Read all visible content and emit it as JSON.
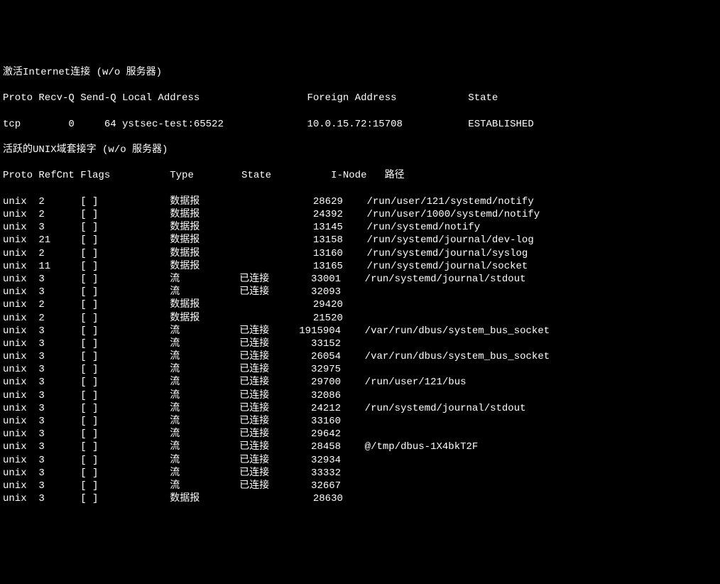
{
  "section1": {
    "title": "激活Internet连接 (w/o 服务器)",
    "header": {
      "proto": "Proto",
      "recvq": "Recv-Q",
      "sendq": "Send-Q",
      "local": "Local Address",
      "foreign": "Foreign Address",
      "state": "State"
    },
    "rows": [
      {
        "proto": "tcp",
        "recvq": "0",
        "sendq": "64",
        "local": "ystsec-test:65522",
        "foreign": "10.0.15.72:15708",
        "state": "ESTABLISHED"
      }
    ]
  },
  "section2": {
    "title": "活跃的UNIX域套接字 (w/o 服务器)",
    "header": {
      "proto": "Proto",
      "refcnt": "RefCnt",
      "flags": "Flags",
      "type": "Type",
      "state": "State",
      "inode": "I-Node",
      "path": "路径"
    },
    "rows": [
      {
        "proto": "unix",
        "refcnt": "2",
        "flags": "[ ]",
        "type": "数据报",
        "state": "",
        "inode": "28629",
        "path": "/run/user/121/systemd/notify"
      },
      {
        "proto": "unix",
        "refcnt": "2",
        "flags": "[ ]",
        "type": "数据报",
        "state": "",
        "inode": "24392",
        "path": "/run/user/1000/systemd/notify"
      },
      {
        "proto": "unix",
        "refcnt": "3",
        "flags": "[ ]",
        "type": "数据报",
        "state": "",
        "inode": "13145",
        "path": "/run/systemd/notify"
      },
      {
        "proto": "unix",
        "refcnt": "21",
        "flags": "[ ]",
        "type": "数据报",
        "state": "",
        "inode": "13158",
        "path": "/run/systemd/journal/dev-log"
      },
      {
        "proto": "unix",
        "refcnt": "2",
        "flags": "[ ]",
        "type": "数据报",
        "state": "",
        "inode": "13160",
        "path": "/run/systemd/journal/syslog"
      },
      {
        "proto": "unix",
        "refcnt": "11",
        "flags": "[ ]",
        "type": "数据报",
        "state": "",
        "inode": "13165",
        "path": "/run/systemd/journal/socket"
      },
      {
        "proto": "unix",
        "refcnt": "3",
        "flags": "[ ]",
        "type": "流",
        "state": "已连接",
        "inode": "33001",
        "path": "/run/systemd/journal/stdout"
      },
      {
        "proto": "unix",
        "refcnt": "3",
        "flags": "[ ]",
        "type": "流",
        "state": "已连接",
        "inode": "32093",
        "path": ""
      },
      {
        "proto": "unix",
        "refcnt": "2",
        "flags": "[ ]",
        "type": "数据报",
        "state": "",
        "inode": "29420",
        "path": ""
      },
      {
        "proto": "unix",
        "refcnt": "2",
        "flags": "[ ]",
        "type": "数据报",
        "state": "",
        "inode": "21520",
        "path": ""
      },
      {
        "proto": "unix",
        "refcnt": "3",
        "flags": "[ ]",
        "type": "流",
        "state": "已连接",
        "inode": "1915904",
        "path": "/var/run/dbus/system_bus_socket"
      },
      {
        "proto": "unix",
        "refcnt": "3",
        "flags": "[ ]",
        "type": "流",
        "state": "已连接",
        "inode": "33152",
        "path": ""
      },
      {
        "proto": "unix",
        "refcnt": "3",
        "flags": "[ ]",
        "type": "流",
        "state": "已连接",
        "inode": "26054",
        "path": "/var/run/dbus/system_bus_socket"
      },
      {
        "proto": "unix",
        "refcnt": "3",
        "flags": "[ ]",
        "type": "流",
        "state": "已连接",
        "inode": "32975",
        "path": ""
      },
      {
        "proto": "unix",
        "refcnt": "3",
        "flags": "[ ]",
        "type": "流",
        "state": "已连接",
        "inode": "29700",
        "path": "/run/user/121/bus"
      },
      {
        "proto": "unix",
        "refcnt": "3",
        "flags": "[ ]",
        "type": "流",
        "state": "已连接",
        "inode": "32086",
        "path": ""
      },
      {
        "proto": "unix",
        "refcnt": "3",
        "flags": "[ ]",
        "type": "流",
        "state": "已连接",
        "inode": "24212",
        "path": "/run/systemd/journal/stdout"
      },
      {
        "proto": "unix",
        "refcnt": "3",
        "flags": "[ ]",
        "type": "流",
        "state": "已连接",
        "inode": "33160",
        "path": ""
      },
      {
        "proto": "unix",
        "refcnt": "3",
        "flags": "[ ]",
        "type": "流",
        "state": "已连接",
        "inode": "29642",
        "path": ""
      },
      {
        "proto": "unix",
        "refcnt": "3",
        "flags": "[ ]",
        "type": "流",
        "state": "已连接",
        "inode": "28458",
        "path": "@/tmp/dbus-1X4bkT2F"
      },
      {
        "proto": "unix",
        "refcnt": "3",
        "flags": "[ ]",
        "type": "流",
        "state": "已连接",
        "inode": "32934",
        "path": ""
      },
      {
        "proto": "unix",
        "refcnt": "3",
        "flags": "[ ]",
        "type": "流",
        "state": "已连接",
        "inode": "33332",
        "path": ""
      },
      {
        "proto": "unix",
        "refcnt": "3",
        "flags": "[ ]",
        "type": "流",
        "state": "已连接",
        "inode": "32667",
        "path": ""
      },
      {
        "proto": "unix",
        "refcnt": "3",
        "flags": "[ ]",
        "type": "数据报",
        "state": "",
        "inode": "28630",
        "path": ""
      }
    ]
  }
}
